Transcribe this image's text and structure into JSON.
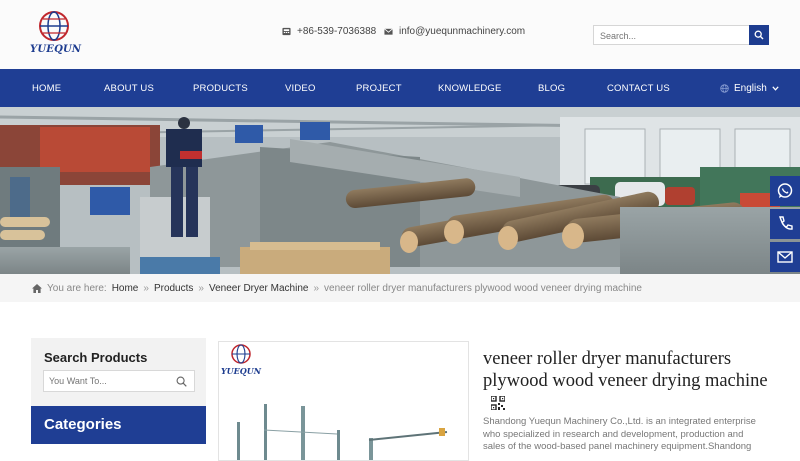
{
  "header": {
    "brand": "YUEQUN",
    "phone": "+86-539-7036388",
    "email": "info@yuequnmachinery.com",
    "search_placeholder": "Search..."
  },
  "nav": {
    "items": [
      {
        "label": "HOME"
      },
      {
        "label": "ABOUT US"
      },
      {
        "label": "PRODUCTS"
      },
      {
        "label": "VIDEO"
      },
      {
        "label": "PROJECT"
      },
      {
        "label": "KNOWLEDGE"
      },
      {
        "label": "BLOG"
      },
      {
        "label": "CONTACT US"
      }
    ],
    "language": "English"
  },
  "breadcrumb": {
    "prefix": "You are here:",
    "home": "Home",
    "products": "Products",
    "category": "Veneer Dryer Machine",
    "current": "veneer roller dryer manufacturers plywood wood veneer drying machine",
    "separator": "»"
  },
  "sidebar": {
    "search_title": "Search Products",
    "search_placeholder": "You Want To...",
    "categories_title": "Categories"
  },
  "product": {
    "gallery_brand": "YUEQUN",
    "title": "veneer roller dryer manufacturers plywood wood veneer drying machine",
    "description": "Shandong Yuequn Machinery Co.,Ltd. is an integrated enterprise who specialized in research and development, production and sales of the wood-based panel machinery equipment.Shandong"
  },
  "side_widgets": [
    "whatsapp-icon",
    "phone-icon",
    "email-icon"
  ],
  "colors": {
    "brand_blue": "#1f3e94",
    "brand_red": "#c0272d",
    "topbar_bg": "#fbfbfb",
    "breadcrumb_bg": "#f5f5f5"
  }
}
